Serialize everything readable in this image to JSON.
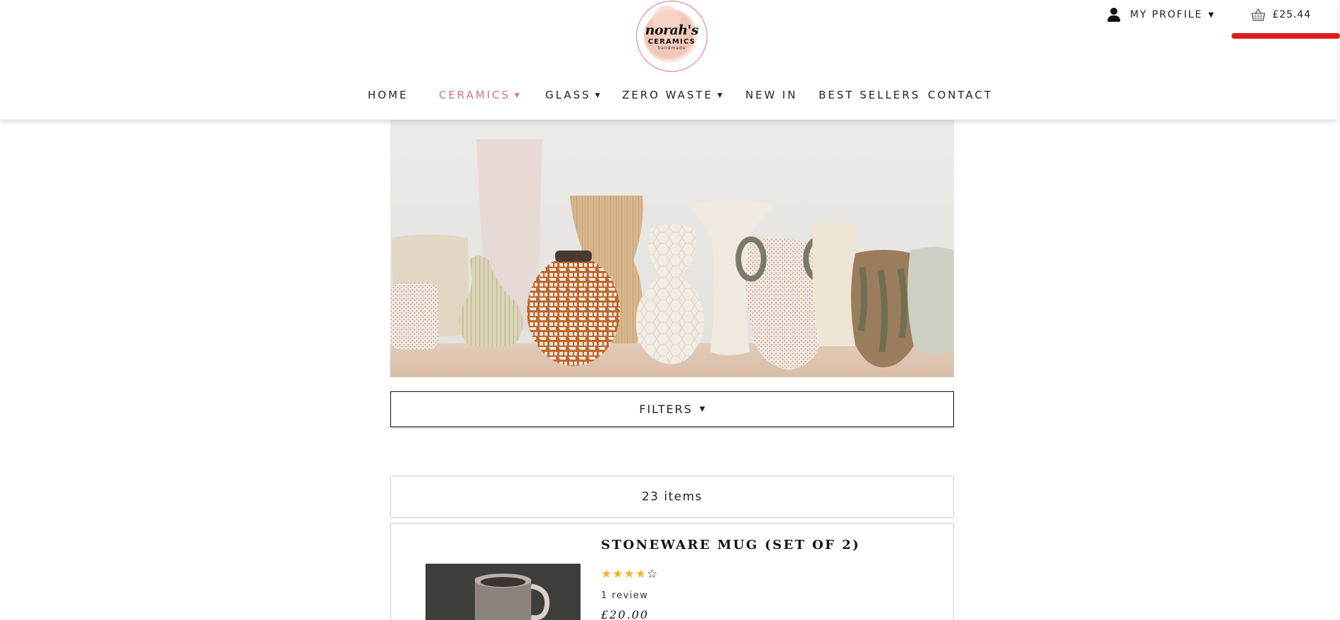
{
  "header": {
    "logo": {
      "line1": "norah's",
      "line2": "CERAMICS",
      "line3": "handmade"
    },
    "profile_label": "MY PROFILE",
    "basket_amount": "£25.44"
  },
  "nav": {
    "items": [
      {
        "label": "HOME",
        "has_dropdown": false,
        "active": false
      },
      {
        "label": "CERAMICS",
        "has_dropdown": true,
        "active": true
      },
      {
        "label": "GLASS",
        "has_dropdown": true,
        "active": false
      },
      {
        "label": "ZERO WASTE",
        "has_dropdown": true,
        "active": false
      },
      {
        "label": "NEW IN",
        "has_dropdown": false,
        "active": false
      },
      {
        "label": "BEST SELLERS",
        "has_dropdown": false,
        "active": false
      },
      {
        "label": "CONTACT",
        "has_dropdown": false,
        "active": false
      }
    ]
  },
  "filters": {
    "label": "FILTERS"
  },
  "listing": {
    "count_text": "23 items",
    "products": [
      {
        "title": "STONEWARE MUG (SET OF 2)",
        "rating": 4,
        "rating_max": 5,
        "reviews": "1 review",
        "price": "£20.00"
      }
    ]
  },
  "colors": {
    "accent": "#d0708a",
    "star": "#f0b429",
    "highlight_underline": "#e01b1b"
  },
  "icons": {
    "profile": "user-icon",
    "basket": "basket-icon",
    "dropdown": "caret-down-icon",
    "star": "star-icon"
  }
}
